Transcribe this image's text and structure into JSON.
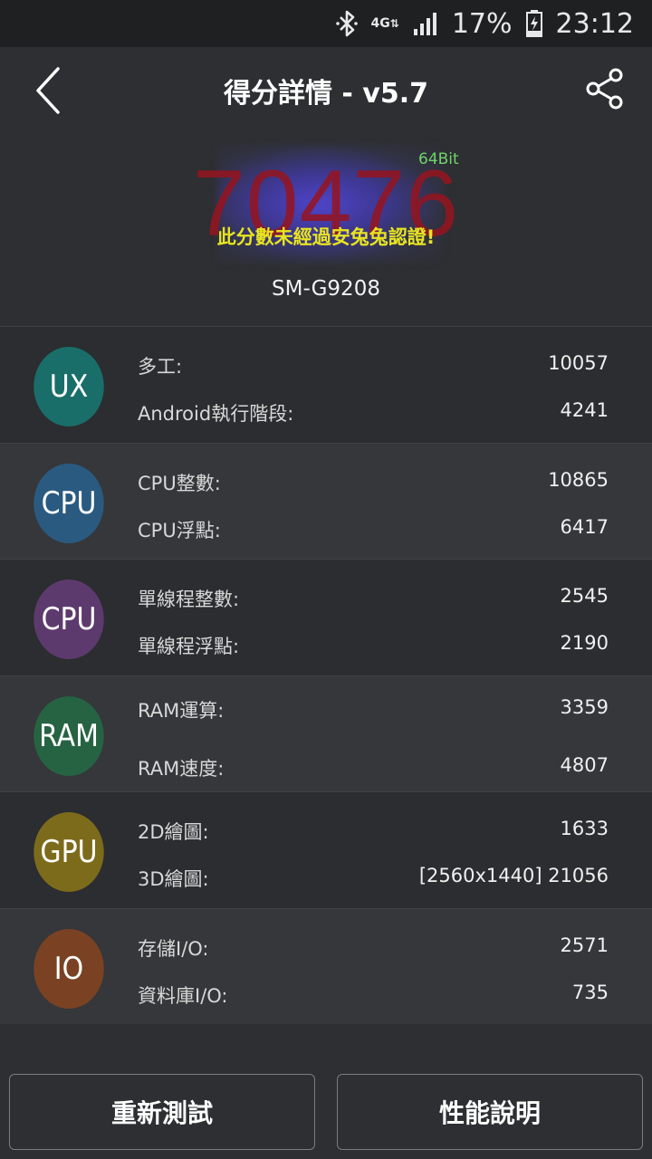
{
  "status_bar": {
    "network": "4G",
    "battery_percent": "17%",
    "time": "23:12"
  },
  "header": {
    "title": "得分詳情 - v5.7"
  },
  "score": {
    "value": "70476",
    "bit_label": "64Bit",
    "warning": "此分數未經過安兔兔認證!",
    "device": "SM-G9208"
  },
  "categories": [
    {
      "badge": "UX",
      "color": "#1a6e6a",
      "metrics": [
        {
          "label": "多工:",
          "value": "10057"
        },
        {
          "label": "Android執行階段:",
          "value": "4241"
        }
      ]
    },
    {
      "badge": "CPU",
      "color": "#2a5a80",
      "metrics": [
        {
          "label": "CPU整數:",
          "value": "10865"
        },
        {
          "label": "CPU浮點:",
          "value": "6417"
        }
      ]
    },
    {
      "badge": "CPU",
      "color": "#5d3a6e",
      "metrics": [
        {
          "label": "單線程整數:",
          "value": "2545"
        },
        {
          "label": "單線程浮點:",
          "value": "2190"
        }
      ]
    },
    {
      "badge": "RAM",
      "color": "#266342",
      "metrics": [
        {
          "label": "RAM運算:",
          "value": "3359"
        },
        {
          "label": "RAM速度:",
          "value": "4807"
        }
      ]
    },
    {
      "badge": "GPU",
      "color": "#7d6b1c",
      "metrics": [
        {
          "label": "2D繪圖:",
          "value": "1633"
        },
        {
          "label": "3D繪圖:",
          "value": "[2560x1440] 21056"
        }
      ]
    },
    {
      "badge": "IO",
      "color": "#7a4223",
      "metrics": [
        {
          "label": "存儲I/O:",
          "value": "2571"
        },
        {
          "label": "資料庫I/O:",
          "value": "735"
        }
      ]
    }
  ],
  "buttons": {
    "retest": "重新測試",
    "info": "性能說明"
  }
}
